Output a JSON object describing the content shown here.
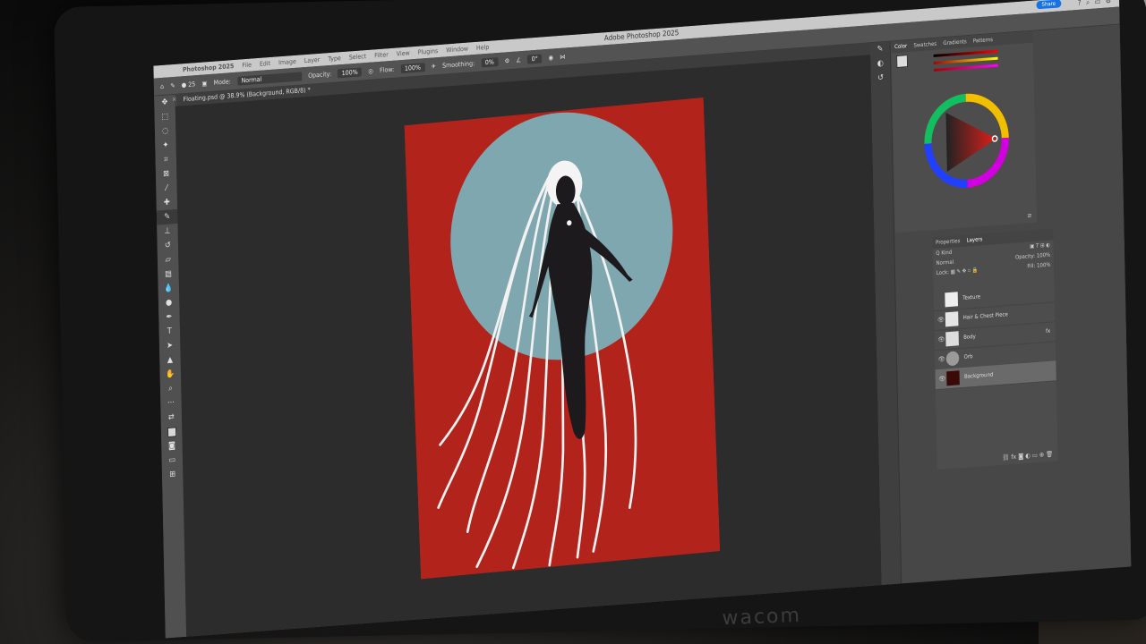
{
  "menubar": {
    "app_menu": "Photoshop 2025",
    "items": [
      "File",
      "Edit",
      "Image",
      "Layer",
      "Type",
      "Select",
      "Filter",
      "View",
      "Plugins",
      "Window",
      "Help"
    ],
    "window_title": "Adobe Photoshop 2025",
    "share_label": "Share"
  },
  "options": {
    "brush_size": "25",
    "mode_label": "Mode:",
    "mode_value": "Normal",
    "opacity_label": "Opacity:",
    "opacity_value": "100%",
    "flow_label": "Flow:",
    "flow_value": "100%",
    "smoothing_label": "Smoothing:",
    "smoothing_value": "0%",
    "angle_value": "0°"
  },
  "document": {
    "tab_label": "Floating.psd @ 38.9% (Background, RGB/8) *"
  },
  "color_panel": {
    "tabs": [
      "Color",
      "Swatches",
      "Gradients",
      "Patterns"
    ],
    "active_tab": "Color"
  },
  "layers_panel": {
    "tabs": [
      "Properties",
      "Layers"
    ],
    "active_tab": "Layers",
    "kind_label": "Q Kind",
    "blend_mode": "Normal",
    "opacity_label": "Opacity:",
    "opacity_value": "100%",
    "lock_label": "Lock:",
    "fill_label": "Fill:",
    "fill_value": "100%",
    "layers": [
      {
        "name": "Texture"
      },
      {
        "name": "Hair & Chest Piece"
      },
      {
        "name": "Body"
      },
      {
        "name": "Orb"
      },
      {
        "name": "Background"
      }
    ]
  },
  "hardware": {
    "brand": "wacom"
  },
  "colors": {
    "artboard_red": "#b2231c",
    "orb_blue": "#7fa7af",
    "accent": "#1473e6"
  }
}
